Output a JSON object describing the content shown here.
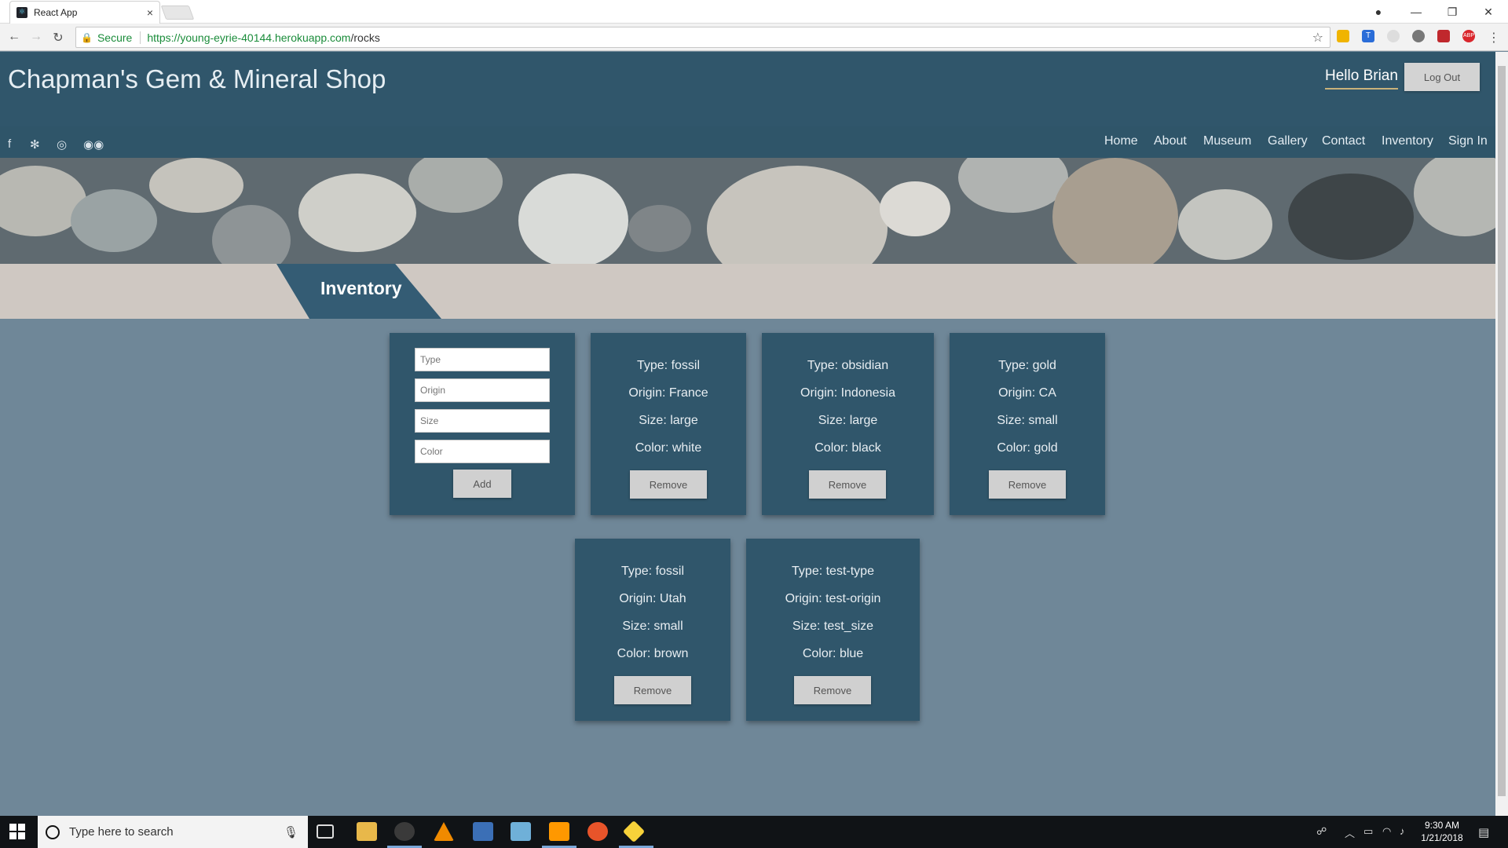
{
  "browser": {
    "tab_title": "React App",
    "tab_close": "×",
    "secure_label": "Secure",
    "url_main": "https://young-eyrie-40144.herokuapp.com",
    "url_path": "/rocks"
  },
  "header": {
    "site_title": "Chapman's Gem & Mineral Shop",
    "greeting": "Hello Brian",
    "logout_label": "Log Out",
    "social_icons": [
      "facebook-icon",
      "yelp-icon",
      "instagram-icon",
      "tripadvisor-icon"
    ],
    "nav": [
      "Home",
      "About",
      "Museum",
      "Gallery",
      "Contact",
      "Inventory",
      "Sign In"
    ]
  },
  "section_title": "Inventory",
  "form": {
    "placeholders": {
      "type": "Type",
      "origin": "Origin",
      "size": "Size",
      "color": "Color"
    },
    "add_label": "Add"
  },
  "inventory": [
    {
      "type": "Type: fossil",
      "origin": "Origin: France",
      "size": "Size: large",
      "color": "Color: white"
    },
    {
      "type": "Type: obsidian",
      "origin": "Origin: Indonesia",
      "size": "Size: large",
      "color": "Color: black"
    },
    {
      "type": "Type: gold",
      "origin": "Origin: CA",
      "size": "Size: small",
      "color": "Color: gold"
    },
    {
      "type": "Type: fossil",
      "origin": "Origin: Utah",
      "size": "Size: small",
      "color": "Color: brown"
    },
    {
      "type": "Type: test-type",
      "origin": "Origin: test-origin",
      "size": "Size: test_size",
      "color": "Color: blue"
    }
  ],
  "remove_label": "Remove",
  "taskbar": {
    "search_placeholder": "Type here to search",
    "time": "9:30 AM",
    "date": "1/21/2018"
  },
  "colors": {
    "header": "#30566b",
    "page_background": "#6f8798",
    "card": "#30566b",
    "button": "#d0d0d0"
  }
}
